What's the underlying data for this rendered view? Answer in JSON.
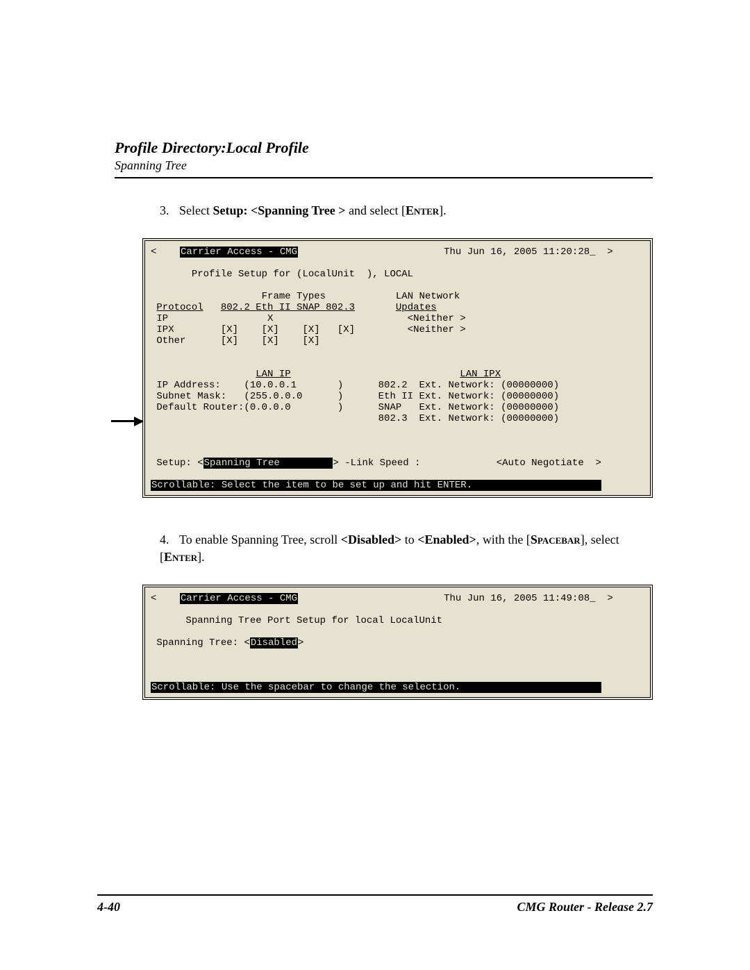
{
  "header": {
    "title": "Profile Directory:Local Profile",
    "subtitle": "Spanning Tree"
  },
  "step3": {
    "number": "3.",
    "pre": "Select ",
    "bold": "Setup:  <Spanning Tree  >",
    "mid": " and select [",
    "key": "Enter",
    "post": "]."
  },
  "term1": {
    "title_left": "Carrier Access - CMG",
    "title_right": "Thu Jun 16, 2005 11:20:28_  >",
    "profile_line": "Profile Setup for (LocalUnit  ), LOCAL",
    "ft_col1": "Protocol",
    "ft_hdr": "Frame Types",
    "ft_cols": "802.2 Eth II SNAP 802.3",
    "lan_net_hdr": "LAN Network",
    "updates": "Updates",
    "row_ip": "IP                 X                       <Neither >",
    "row_ipx": "IPX        [X]    [X]    [X]   [X]         <Neither >",
    "row_other": "Other      [X]    [X]    [X]",
    "lanip_hdr": "LAN IP",
    "lanipx_hdr": "LAN IPX",
    "ip_addr": "IP Address:    (10.0.0.1       )      802.2  Ext. Network: (00000000)",
    "subnet": "Subnet Mask:   (255.0.0.0      )      Eth II Ext. Network: (00000000)",
    "defroute": "Default Router:(0.0.0.0        )      SNAP   Ext. Network: (00000000)",
    "ipxrow4": "                                      802.3  Ext. Network: (00000000)",
    "setup_label": "Setup: <",
    "setup_value": "Spanning Tree         ",
    "setup_mid": "> -Link Speed :             <Auto Negotiate  >",
    "help": "Scrollable: Select the item to be set up and hit ENTER.                      "
  },
  "step4": {
    "number": "4.",
    "pre": "To enable Spanning Tree, scroll ",
    "b1": "<Disabled>",
    "mid1": " to ",
    "b2": "<Enabled>",
    "mid2": ", with the [",
    "key1": "Spacebar",
    "mid3": "], select [",
    "key2": "Enter",
    "post": "]."
  },
  "term2": {
    "title_left": "Carrier Access - CMG",
    "title_right": "Thu Jun 16, 2005 11:49:08_  >",
    "subtitle": "Spanning Tree Port Setup for local LocalUnit",
    "st_label": "Spanning Tree: <",
    "st_value": "Disabled",
    "st_close": ">",
    "help": "Scrollable: Use the spacebar to change the selection.                        "
  },
  "footer": {
    "left": "4-40",
    "right": "CMG Router - Release 2.7"
  }
}
